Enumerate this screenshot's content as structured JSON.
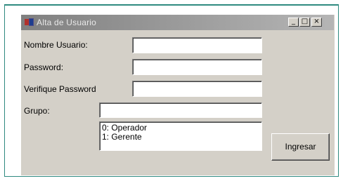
{
  "window": {
    "title": "Alta de Usuario",
    "minimize_glyph": "_",
    "maximize_glyph": "□",
    "close_glyph": "×"
  },
  "form": {
    "username_label": "Nombre Usuario:",
    "username_value": "",
    "password_label": "Password:",
    "password_value": "",
    "verify_label": "Verifique Password",
    "verify_value": "",
    "group_label": "Grupo:",
    "group_value": "",
    "group_options": [
      "0: Operador",
      "1: Gerente"
    ],
    "submit_label": "Ingresar"
  },
  "colors": {
    "window_face": "#d4d0c8",
    "title_gradient_start": "#808080",
    "title_gradient_end": "#b5b5b5",
    "frame_accent": "#2f8a80"
  }
}
